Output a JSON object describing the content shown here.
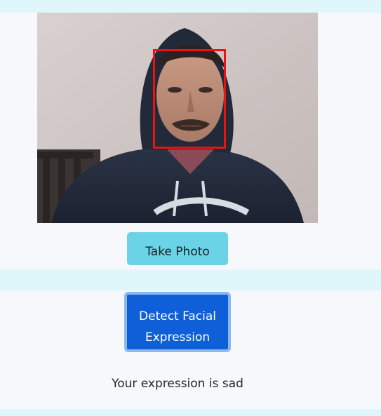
{
  "webcam": {
    "face_box_color": "#ef1010"
  },
  "controls": {
    "take_photo_label": "Take Photo",
    "detect_label": "Detect Facial Expression",
    "take_photo_color": "#6bd3e6",
    "detect_color": "#0f5fd8"
  },
  "result": {
    "text": "Your expression is sad"
  }
}
